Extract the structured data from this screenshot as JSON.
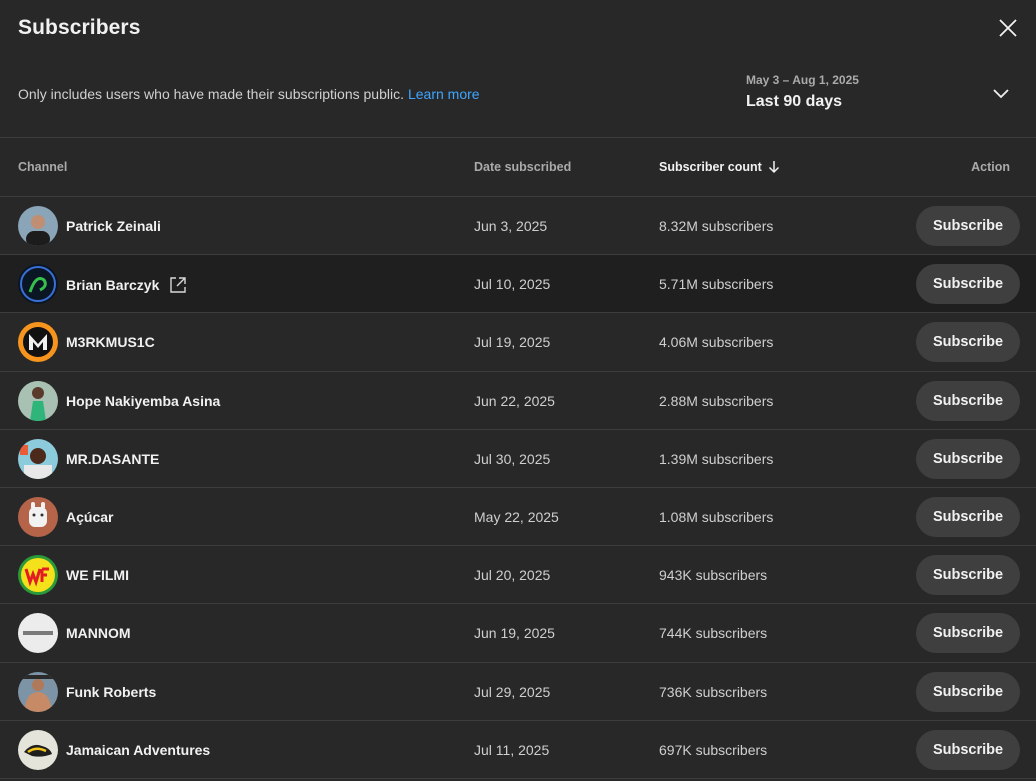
{
  "dialog": {
    "title": "Subscribers",
    "note": "Only includes users who have made their subscriptions public.",
    "learn_more": "Learn more",
    "range_dates": "May 3 – Aug 1, 2025",
    "range_label": "Last 90 days"
  },
  "table": {
    "headers": {
      "channel": "Channel",
      "date": "Date subscribed",
      "count": "Subscriber count",
      "action": "Action"
    },
    "button_label": "Subscribe",
    "rows": [
      {
        "name": "Patrick Zeinali",
        "date": "Jun 3, 2025",
        "subs": "8.32M subscribers"
      },
      {
        "name": "Brian Barczyk",
        "date": "Jul 10, 2025",
        "subs": "5.71M subscribers"
      },
      {
        "name": "M3RKMUS1C",
        "date": "Jul 19, 2025",
        "subs": "4.06M subscribers"
      },
      {
        "name": "Hope Nakiyemba Asina",
        "date": "Jun 22, 2025",
        "subs": "2.88M subscribers"
      },
      {
        "name": "MR.DASANTE",
        "date": "Jul 30, 2025",
        "subs": "1.39M subscribers"
      },
      {
        "name": "Açúcar",
        "date": "May 22, 2025",
        "subs": "1.08M subscribers"
      },
      {
        "name": "WE FILMI",
        "date": "Jul 20, 2025",
        "subs": "943K subscribers"
      },
      {
        "name": "MANNOM",
        "date": "Jun 19, 2025",
        "subs": "744K subscribers"
      },
      {
        "name": "Funk Roberts",
        "date": "Jul 29, 2025",
        "subs": "736K subscribers"
      },
      {
        "name": "Jamaican Adventures",
        "date": "Jul 11, 2025",
        "subs": "697K subscribers"
      }
    ]
  },
  "avatar_colors": [
    "#6b8fa8",
    "#0d1a2a",
    "#f7941d",
    "#9bb7a6",
    "#8cc7d8",
    "#b5644a",
    "#f5e11b",
    "#e8e8e8",
    "#7a8fa0",
    "#dcdcd0"
  ],
  "icons": {
    "close": "close-icon",
    "chevron": "chevron-down-icon",
    "sort": "arrow-down-icon",
    "external": "external-link-icon"
  }
}
